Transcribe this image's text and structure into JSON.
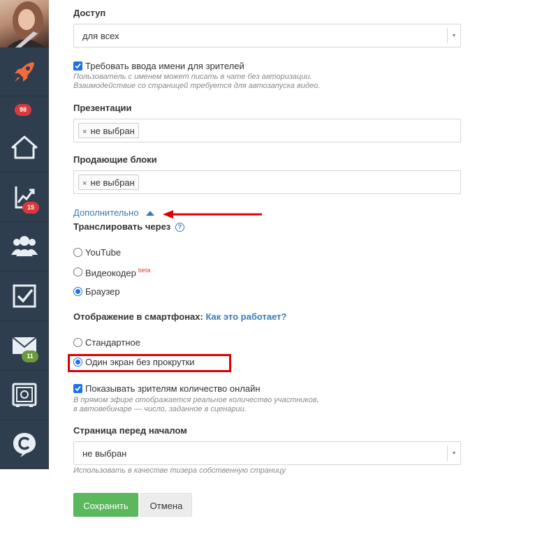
{
  "sidebar": {
    "items": [
      {
        "icon": "rocket-icon",
        "badge": "98",
        "badge_color": "#d9393c"
      },
      {
        "icon": "home-icon"
      },
      {
        "icon": "chart-icon",
        "badge": "15",
        "badge_color": "#d9393c"
      },
      {
        "icon": "users-icon"
      },
      {
        "icon": "checkbox-icon"
      },
      {
        "icon": "mail-icon",
        "badge": "11",
        "badge_color": "#6b9a3a"
      },
      {
        "icon": "safe-icon"
      },
      {
        "icon": "chat-c-icon"
      }
    ]
  },
  "form": {
    "access": {
      "label": "Доступ",
      "value": "для всех"
    },
    "require_name": {
      "label": "Требовать ввода имени для зрителей",
      "checked": true,
      "hint1": "Пользователь с именем может писать в чате без авторизации.",
      "hint2": "Взаимодействие со страницей требуется для автозапуска видео."
    },
    "presentations": {
      "label": "Презентации",
      "tag": "не выбран"
    },
    "selling_blocks": {
      "label": "Продающие блоки",
      "tag": "не выбран"
    },
    "advanced_link": "Дополнительно",
    "broadcast": {
      "label": "Транслировать через",
      "help": "?",
      "options": [
        {
          "label": "YouTube",
          "selected": false
        },
        {
          "label": "Видеокодер",
          "sup": "beta",
          "selected": false
        },
        {
          "label": "Браузер",
          "selected": true
        }
      ]
    },
    "mobile": {
      "label": "Отображение в смартфонах:",
      "link": "Как это работает?",
      "options": [
        {
          "label": "Стандартное",
          "selected": false
        },
        {
          "label": "Один экран без прокрутки",
          "selected": true
        }
      ]
    },
    "show_online": {
      "label": "Показывать зрителям количество онлайн",
      "checked": true,
      "hint1": "В прямом эфире отображается реальное количество участников,",
      "hint2": "в автовебинаре — число, заданное в сценарии."
    },
    "pre_page": {
      "label": "Страница перед началом",
      "value": "не выбран",
      "hint": "Использовать в качестве тизера собственную страницу"
    },
    "save_label": "Сохранить",
    "cancel_label": "Отмена"
  },
  "colors": {
    "accent": "#1a73e8",
    "link": "#3a7ab8",
    "save": "#5cb85c",
    "annotation": "#e00000"
  }
}
